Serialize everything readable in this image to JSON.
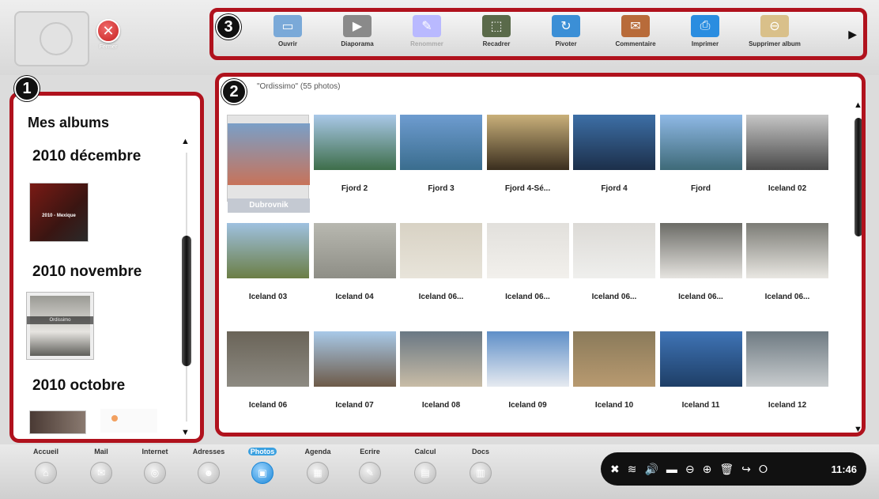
{
  "header": {
    "close_label": "Fermer"
  },
  "toolbar": {
    "badge": "3",
    "items": [
      {
        "label": "Ouvrir",
        "icon": "folder-open-icon",
        "color": "#7aa9d8"
      },
      {
        "label": "Diaporama",
        "icon": "play-icon",
        "color": "#8a8a8a"
      },
      {
        "label": "Renommer",
        "icon": "rename-icon",
        "color": "#b9b9ff"
      },
      {
        "label": "Recadrer",
        "icon": "crop-icon",
        "color": "#5a6a4a"
      },
      {
        "label": "Pivoter",
        "icon": "rotate-icon",
        "color": "#3b8fd6"
      },
      {
        "label": "Commentaire",
        "icon": "comment-icon",
        "color": "#b86b3a"
      },
      {
        "label": "Imprimer",
        "icon": "printer-icon",
        "color": "#2a8de0"
      },
      {
        "label": "Supprimer album",
        "icon": "delete-album-icon",
        "color": "#d9c08a"
      }
    ],
    "more": "▶"
  },
  "sidebar": {
    "badge": "1",
    "title": "Mes albums",
    "sections": [
      {
        "month": "2010 décembre",
        "album_text": "2010 - Mexique"
      },
      {
        "month": "2010 novembre",
        "album_text": "Ordissimo"
      },
      {
        "month": "2010 octobre"
      }
    ],
    "scroll_up": "▲",
    "scroll_down": "▼"
  },
  "grid": {
    "badge": "2",
    "caption": "\"Ordissimo\" (55 photos)",
    "photos": [
      {
        "label": "Dubrovnik",
        "colors": [
          "#7a9fc7",
          "#c7735a"
        ]
      },
      {
        "label": "Fjord 2",
        "colors": [
          "#a9c8e8",
          "#3e6e4a"
        ]
      },
      {
        "label": "Fjord 3",
        "colors": [
          "#6e9cd0",
          "#3a6d8e"
        ]
      },
      {
        "label": "Fjord 4-Sé...",
        "colors": [
          "#c9b07a",
          "#3a2e1e"
        ]
      },
      {
        "label": "Fjord 4",
        "colors": [
          "#3d6fa6",
          "#1c2f4a"
        ]
      },
      {
        "label": "Fjord",
        "colors": [
          "#8fb9e6",
          "#3e6a78"
        ]
      },
      {
        "label": "Iceland 02",
        "colors": [
          "#c6c6c6",
          "#4a4a4a"
        ]
      },
      {
        "label": "Iceland 03",
        "colors": [
          "#9fc1e0",
          "#6b7e45"
        ]
      },
      {
        "label": "Iceland 04",
        "colors": [
          "#b8b8b0",
          "#8e8e86"
        ]
      },
      {
        "label": "Iceland 06...",
        "colors": [
          "#d8d2c4",
          "#e8e4da"
        ]
      },
      {
        "label": "Iceland 06...",
        "colors": [
          "#e2e0dc",
          "#f2f0ec"
        ]
      },
      {
        "label": "Iceland 06...",
        "colors": [
          "#dcdad6",
          "#efefed"
        ]
      },
      {
        "label": "Iceland 06...",
        "colors": [
          "#6b6b66",
          "#e6e4e0"
        ]
      },
      {
        "label": "Iceland 06...",
        "colors": [
          "#7c7c76",
          "#e9e7e2"
        ]
      },
      {
        "label": "Iceland 06",
        "colors": [
          "#6a6458",
          "#8d8a82"
        ]
      },
      {
        "label": "Iceland 07",
        "colors": [
          "#a8c9e8",
          "#6d5a48"
        ]
      },
      {
        "label": "Iceland 08",
        "colors": [
          "#6a7884",
          "#c8bca6"
        ]
      },
      {
        "label": "Iceland 09",
        "colors": [
          "#5f8fc8",
          "#e6eaf0"
        ]
      },
      {
        "label": "Iceland 10",
        "colors": [
          "#8a7a5a",
          "#b89a70"
        ]
      },
      {
        "label": "Iceland 11",
        "colors": [
          "#3f74b6",
          "#1e3e66"
        ]
      },
      {
        "label": "Iceland 12",
        "colors": [
          "#6e7a82",
          "#c8ccce"
        ]
      }
    ],
    "scroll_up": "▲",
    "scroll_down": "▼"
  },
  "dock": {
    "items": [
      {
        "label": "Accueil",
        "icon": "home-icon"
      },
      {
        "label": "Mail",
        "icon": "mail-icon"
      },
      {
        "label": "Internet",
        "icon": "internet-icon"
      },
      {
        "label": "Adresses",
        "icon": "addresses-icon"
      },
      {
        "label": "Photos",
        "icon": "photos-icon",
        "active": true
      },
      {
        "label": "Agenda",
        "icon": "agenda-icon"
      },
      {
        "label": "Ecrire",
        "icon": "write-icon"
      },
      {
        "label": "Calcul",
        "icon": "calc-icon"
      },
      {
        "label": "Docs",
        "icon": "docs-icon"
      }
    ]
  },
  "tray": {
    "icons": [
      "✖",
      "≋",
      "🔊",
      "▬",
      "⊖",
      "⊕",
      "🗑",
      "↪",
      "⭘"
    ],
    "clock": "11:46"
  }
}
